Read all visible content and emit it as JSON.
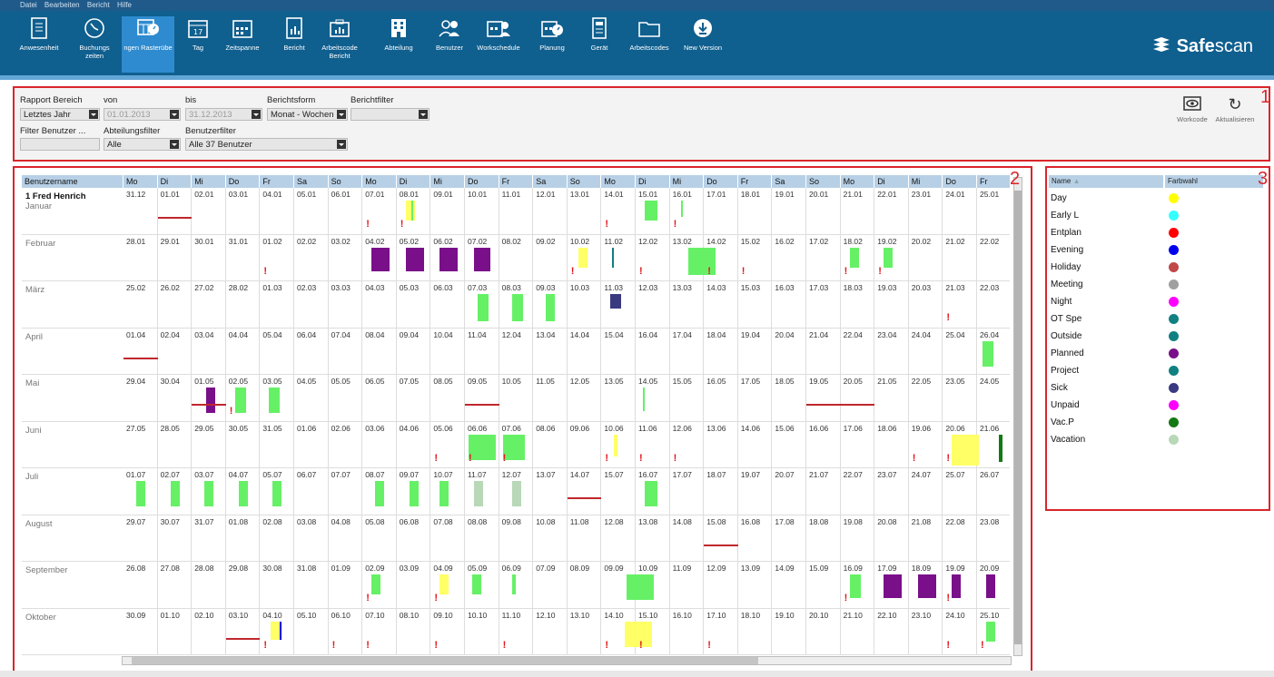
{
  "menubar": {
    "items": [
      "Datei",
      "Bearbeiten",
      "Bericht",
      "Hilfe"
    ]
  },
  "toolbar": {
    "buttons": [
      {
        "label": "Anwesenheit",
        "icon": "attendance-icon"
      },
      {
        "label": "Buchungs zeiten",
        "icon": "clock-icon"
      },
      {
        "label": "ngen Rasterübe",
        "icon": "raster-icon",
        "active": true
      },
      {
        "label": "Tag",
        "icon": "calendar-day-icon"
      },
      {
        "label": "Zeitspanne",
        "icon": "calendar-range-icon"
      },
      {
        "label": "Bericht",
        "icon": "report-icon"
      },
      {
        "label": "Arbeitscode Bericht",
        "icon": "workcode-report-icon"
      },
      {
        "label": "Abteilung",
        "icon": "department-icon"
      },
      {
        "label": "Benutzer",
        "icon": "users-icon"
      },
      {
        "label": "Workschedule",
        "icon": "workschedule-icon"
      },
      {
        "label": "Planung",
        "icon": "planning-icon"
      },
      {
        "label": "Gerät",
        "icon": "device-icon"
      },
      {
        "label": "Arbeitscodes",
        "icon": "folder-icon"
      },
      {
        "label": "New Version",
        "icon": "download-icon"
      }
    ],
    "logo": {
      "strong": "Safe",
      "light": "scan"
    }
  },
  "filters": {
    "rapport_label": "Rapport Bereich",
    "rapport_value": "Letztes Jahr",
    "von_label": "von",
    "von_value": "01.01.2013",
    "bis_label": "bis",
    "bis_value": "31.12.2013",
    "berichtsform_label": "Berichtsform",
    "berichtsform_value": "Monat - Wochen",
    "berichtfilter_label": "Berichtfilter",
    "berichtfilter_value": "",
    "filter_benutzer_label": "Filter Benutzer ...",
    "abteilungsfilter_label": "Abteilungsfilter",
    "abteilungsfilter_value": "Alle",
    "benutzerfilter_label": "Benutzerfilter",
    "benutzerfilter_value": "Alle 37 Benutzer",
    "workcode_label": "Workcode",
    "aktualisieren_label": "Aktualisieren"
  },
  "annotations": [
    "1",
    "2",
    "3"
  ],
  "grid": {
    "name_header": "Benutzername",
    "user": "1 Fred Henrich",
    "days": [
      "Mo",
      "Di",
      "Mi",
      "Do",
      "Fr",
      "Sa",
      "So",
      "Mo",
      "Di",
      "Mi",
      "Do",
      "Fr",
      "Sa",
      "So",
      "Mo",
      "Di",
      "Mi",
      "Do",
      "Fr",
      "Sa",
      "So",
      "Mo",
      "Di",
      "Mi",
      "Do",
      "Fr"
    ],
    "rows": [
      {
        "month": "Januar",
        "dates": [
          "31.12",
          "01.01",
          "02.01",
          "03.01",
          "04.01",
          "05.01",
          "06.01",
          "07.01",
          "08.01",
          "09.01",
          "10.01",
          "11.01",
          "12.01",
          "13.01",
          "14.01",
          "15.01",
          "16.01",
          "17.01",
          "18.01",
          "19.01",
          "20.01",
          "21.01",
          "22.01",
          "23.01",
          "24.01",
          "25.01"
        ]
      },
      {
        "month": "Februar",
        "dates": [
          "28.01",
          "29.01",
          "30.01",
          "31.01",
          "01.02",
          "02.02",
          "03.02",
          "04.02",
          "05.02",
          "06.02",
          "07.02",
          "08.02",
          "09.02",
          "10.02",
          "11.02",
          "12.02",
          "13.02",
          "14.02",
          "15.02",
          "16.02",
          "17.02",
          "18.02",
          "19.02",
          "20.02",
          "21.02",
          "22.02"
        ]
      },
      {
        "month": "März",
        "dates": [
          "25.02",
          "26.02",
          "27.02",
          "28.02",
          "01.03",
          "02.03",
          "03.03",
          "04.03",
          "05.03",
          "06.03",
          "07.03",
          "08.03",
          "09.03",
          "10.03",
          "11.03",
          "12.03",
          "13.03",
          "14.03",
          "15.03",
          "16.03",
          "17.03",
          "18.03",
          "19.03",
          "20.03",
          "21.03",
          "22.03"
        ]
      },
      {
        "month": "April",
        "dates": [
          "01.04",
          "02.04",
          "03.04",
          "04.04",
          "05.04",
          "06.04",
          "07.04",
          "08.04",
          "09.04",
          "10.04",
          "11.04",
          "12.04",
          "13.04",
          "14.04",
          "15.04",
          "16.04",
          "17.04",
          "18.04",
          "19.04",
          "20.04",
          "21.04",
          "22.04",
          "23.04",
          "24.04",
          "25.04",
          "26.04"
        ]
      },
      {
        "month": "Mai",
        "dates": [
          "29.04",
          "30.04",
          "01.05",
          "02.05",
          "03.05",
          "04.05",
          "05.05",
          "06.05",
          "07.05",
          "08.05",
          "09.05",
          "10.05",
          "11.05",
          "12.05",
          "13.05",
          "14.05",
          "15.05",
          "16.05",
          "17.05",
          "18.05",
          "19.05",
          "20.05",
          "21.05",
          "22.05",
          "23.05",
          "24.05"
        ]
      },
      {
        "month": "Juni",
        "dates": [
          "27.05",
          "28.05",
          "29.05",
          "30.05",
          "31.05",
          "01.06",
          "02.06",
          "03.06",
          "04.06",
          "05.06",
          "06.06",
          "07.06",
          "08.06",
          "09.06",
          "10.06",
          "11.06",
          "12.06",
          "13.06",
          "14.06",
          "15.06",
          "16.06",
          "17.06",
          "18.06",
          "19.06",
          "20.06",
          "21.06"
        ]
      },
      {
        "month": "Juli",
        "dates": [
          "01.07",
          "02.07",
          "03.07",
          "04.07",
          "05.07",
          "06.07",
          "07.07",
          "08.07",
          "09.07",
          "10.07",
          "11.07",
          "12.07",
          "13.07",
          "14.07",
          "15.07",
          "16.07",
          "17.07",
          "18.07",
          "19.07",
          "20.07",
          "21.07",
          "22.07",
          "23.07",
          "24.07",
          "25.07",
          "26.07"
        ]
      },
      {
        "month": "August",
        "dates": [
          "29.07",
          "30.07",
          "31.07",
          "01.08",
          "02.08",
          "03.08",
          "04.08",
          "05.08",
          "06.08",
          "07.08",
          "08.08",
          "09.08",
          "10.08",
          "11.08",
          "12.08",
          "13.08",
          "14.08",
          "15.08",
          "16.08",
          "17.08",
          "18.08",
          "19.08",
          "20.08",
          "21.08",
          "22.08",
          "23.08"
        ]
      },
      {
        "month": "September",
        "dates": [
          "26.08",
          "27.08",
          "28.08",
          "29.08",
          "30.08",
          "31.08",
          "01.09",
          "02.09",
          "03.09",
          "04.09",
          "05.09",
          "06.09",
          "07.09",
          "08.09",
          "09.09",
          "10.09",
          "11.09",
          "12.09",
          "13.09",
          "14.09",
          "15.09",
          "16.09",
          "17.09",
          "18.09",
          "19.09",
          "20.09"
        ]
      },
      {
        "month": "Oktober",
        "dates": [
          "30.09",
          "01.10",
          "02.10",
          "03.10",
          "04.10",
          "05.10",
          "06.10",
          "07.10",
          "08.10",
          "09.10",
          "10.10",
          "11.10",
          "12.10",
          "13.10",
          "14.10",
          "15.10",
          "16.10",
          "17.10",
          "18.10",
          "19.10",
          "20.10",
          "21.10",
          "22.10",
          "23.10",
          "24.10",
          "25.10"
        ]
      }
    ]
  },
  "legend": {
    "name_header": "Name",
    "color_header": "Farbwahl",
    "items": [
      {
        "name": "Day",
        "color": "#ffff00"
      },
      {
        "name": "Early L",
        "color": "#33ffff"
      },
      {
        "name": "Entplan",
        "color": "#ff0000"
      },
      {
        "name": "Evening",
        "color": "#0000ee"
      },
      {
        "name": "Holiday",
        "color": "#c04848"
      },
      {
        "name": "Meeting",
        "color": "#a0a0a0"
      },
      {
        "name": "Night",
        "color": "#ff00ff"
      },
      {
        "name": "OT Spe",
        "color": "#118080"
      },
      {
        "name": "Outside",
        "color": "#118080"
      },
      {
        "name": "Planned",
        "color": "#7a0f8a"
      },
      {
        "name": "Project",
        "color": "#118080"
      },
      {
        "name": "Sick",
        "color": "#3a3a80"
      },
      {
        "name": "Unpaid",
        "color": "#ff00ff"
      },
      {
        "name": "Vac.P",
        "color": "#137a13"
      },
      {
        "name": "Vacation",
        "color": "#b8d8b8"
      }
    ]
  }
}
